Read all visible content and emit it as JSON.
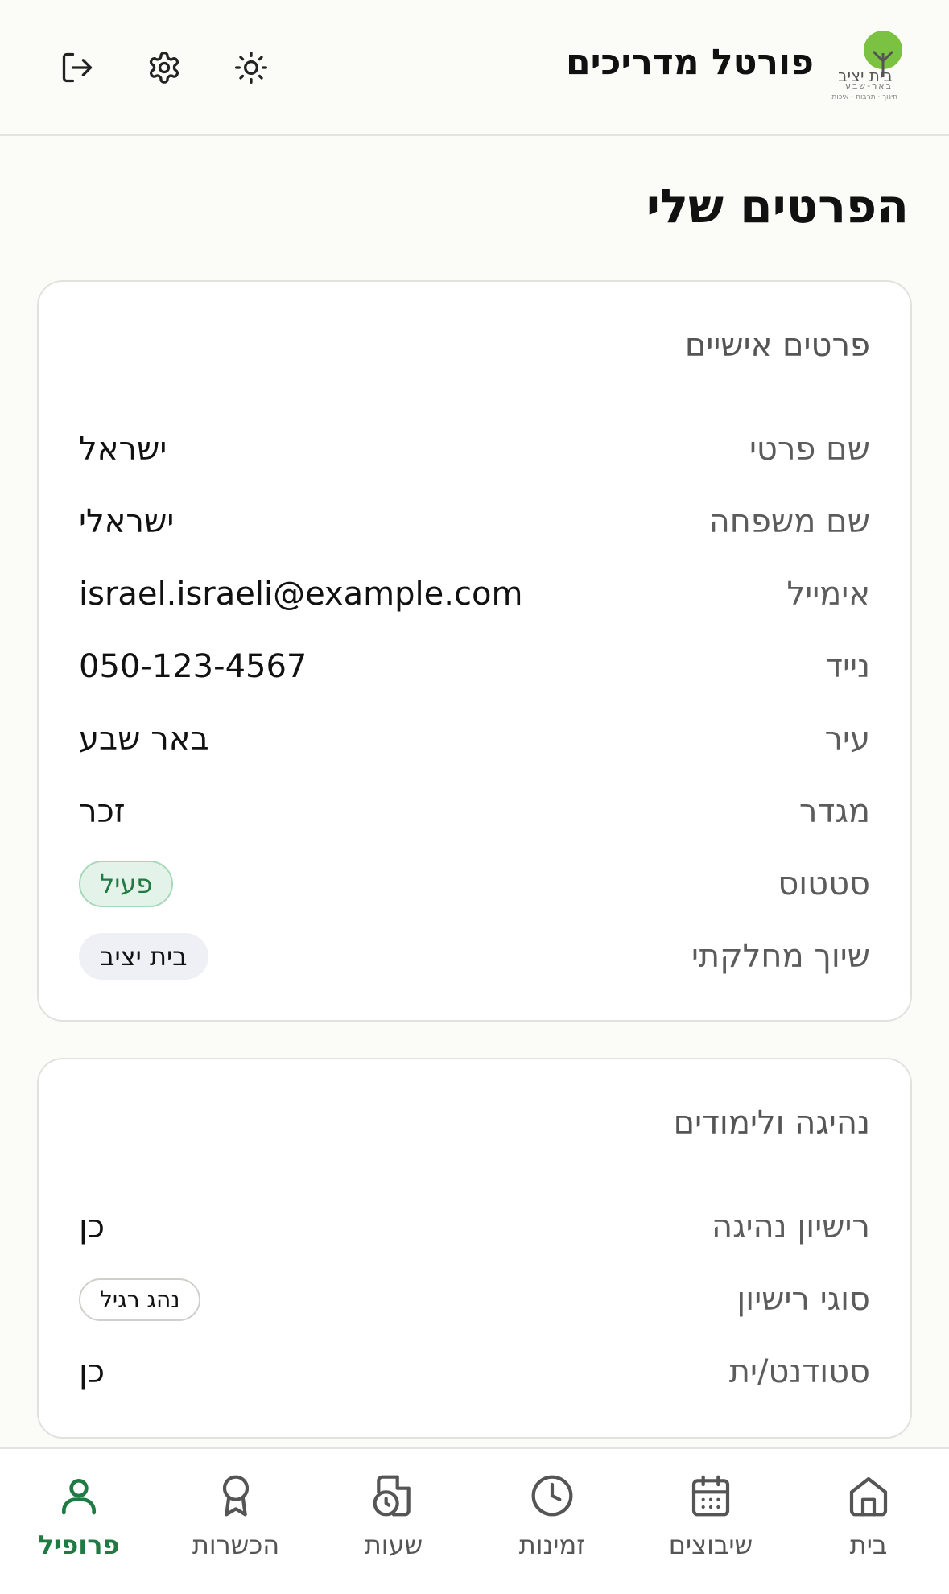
{
  "header": {
    "title": "פורטל מדריכים",
    "logo_text": "בית יציב",
    "logo_subtext": "באר-שבע",
    "logo_tagline": "חינוך · תרבות · איכות"
  },
  "page": {
    "title": "הפרטים שלי"
  },
  "personal": {
    "title": "פרטים אישיים",
    "rows": [
      {
        "label": "שם פרטי",
        "value": "ישראל"
      },
      {
        "label": "שם משפחה",
        "value": "ישראלי"
      },
      {
        "label": "אימייל",
        "value": "israel.israeli@example.com"
      },
      {
        "label": "נייד",
        "value": "050-123-4567"
      },
      {
        "label": "עיר",
        "value": "באר שבע"
      },
      {
        "label": "מגדר",
        "value": "זכר"
      },
      {
        "label": "סטטוס",
        "value": "פעיל"
      },
      {
        "label": "שיוך מחלקתי",
        "value": "בית יציב"
      }
    ]
  },
  "driving": {
    "title": "נהיגה ולימודים",
    "rows": [
      {
        "label": "רישיון נהיגה",
        "value": "כן"
      },
      {
        "label": "סוגי רישיון",
        "value": "נהג רגיל"
      },
      {
        "label": "סטודנט/ית",
        "value": "כן"
      }
    ]
  },
  "nav": {
    "items": [
      {
        "label": "פרופיל",
        "icon": "user-icon"
      },
      {
        "label": "הכשרות",
        "icon": "award-icon"
      },
      {
        "label": "שעות",
        "icon": "file-clock-icon"
      },
      {
        "label": "זמינות",
        "icon": "clock-icon"
      },
      {
        "label": "שיבוצים",
        "icon": "calendar-icon"
      },
      {
        "label": "בית",
        "icon": "home-icon"
      }
    ],
    "active": "פרופיל"
  },
  "colors": {
    "accent": "#1f7a43",
    "background": "#fbfbf7",
    "logo_green": "#7cc242"
  }
}
